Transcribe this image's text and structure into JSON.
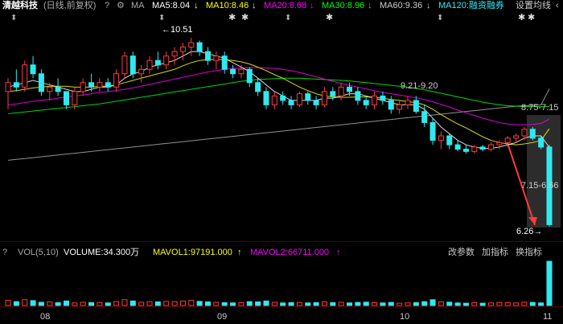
{
  "header": {
    "stock_name": "清越科技",
    "mode": "(日线,前复权)",
    "help": "?",
    "ma_label": "MA",
    "ma5": "MA5:8.04",
    "ma10": "MA10:8.46",
    "ma20": "MA20:8.68",
    "ma30": "MA30:8.96",
    "ma60": "MA60:9.36",
    "ma120": "MA120:融资融券",
    "settings": "设置均线",
    "arrow_down": "↓",
    "more": "‹"
  },
  "annotations": {
    "high": "10.51",
    "low": "6.26",
    "band1": "9.21-9.20",
    "band2": "8.75-7.15",
    "band3": "7.15-6.66"
  },
  "volume": {
    "header_left": "VOL(5,10)",
    "volume": "VOLUME:34.300万",
    "mavol1": "MAVOL1:97191.000",
    "mavol2": "MAVOL2:66711.000",
    "params": "改参数",
    "add_indicator": "加指标",
    "swap_indicator": "换指标",
    "help": "?"
  },
  "xaxis": [
    "08",
    "09",
    "10",
    "11"
  ],
  "colors": {
    "up": "#ff3b3b",
    "down": "#30e8f0",
    "ma5": "#ffffff",
    "ma10": "#ffff00",
    "ma20": "#ff00ff",
    "ma30": "#00ff00",
    "ma60": "#aaaaaa"
  },
  "chart_data": {
    "type": "candlestick",
    "ylim": [
      6.0,
      11.0
    ],
    "candles": [
      [
        9.3,
        9.6,
        8.9,
        9.5
      ],
      [
        9.5,
        9.8,
        9.3,
        9.4
      ],
      [
        9.4,
        10.0,
        9.3,
        9.9
      ],
      [
        9.9,
        10.1,
        9.6,
        9.7
      ],
      [
        9.7,
        9.8,
        9.2,
        9.3
      ],
      [
        9.3,
        9.5,
        9.1,
        9.4
      ],
      [
        9.4,
        9.6,
        9.2,
        9.3
      ],
      [
        9.3,
        9.3,
        8.9,
        9.0
      ],
      [
        9.0,
        9.4,
        8.9,
        9.3
      ],
      [
        9.3,
        9.6,
        9.2,
        9.5
      ],
      [
        9.5,
        9.7,
        9.3,
        9.4
      ],
      [
        9.4,
        9.6,
        9.3,
        9.5
      ],
      [
        9.5,
        9.6,
        9.3,
        9.4
      ],
      [
        9.4,
        9.8,
        9.3,
        9.7
      ],
      [
        9.7,
        10.2,
        9.6,
        10.1
      ],
      [
        10.1,
        10.2,
        9.6,
        9.7
      ],
      [
        9.7,
        9.9,
        9.5,
        9.8
      ],
      [
        9.8,
        10.1,
        9.7,
        10.0
      ],
      [
        10.0,
        10.2,
        9.8,
        9.9
      ],
      [
        9.9,
        10.2,
        9.8,
        10.1
      ],
      [
        10.1,
        10.3,
        9.9,
        10.2
      ],
      [
        10.2,
        10.4,
        10.0,
        10.3
      ],
      [
        10.3,
        10.51,
        10.1,
        10.4
      ],
      [
        10.4,
        10.45,
        10.1,
        10.2
      ],
      [
        10.2,
        10.3,
        9.9,
        10.0
      ],
      [
        10.0,
        10.2,
        9.8,
        10.1
      ],
      [
        10.1,
        10.2,
        9.7,
        9.8
      ],
      [
        9.8,
        9.9,
        9.6,
        9.7
      ],
      [
        9.7,
        9.9,
        9.6,
        9.8
      ],
      [
        9.8,
        9.85,
        9.4,
        9.5
      ],
      [
        9.5,
        9.6,
        9.2,
        9.3
      ],
      [
        9.3,
        9.4,
        8.9,
        9.0
      ],
      [
        9.0,
        9.3,
        8.9,
        9.2
      ],
      [
        9.2,
        9.3,
        9.0,
        9.1
      ],
      [
        9.1,
        9.2,
        8.9,
        9.0
      ],
      [
        9.0,
        9.3,
        8.95,
        9.25
      ],
      [
        9.25,
        9.3,
        9.0,
        9.1
      ],
      [
        9.1,
        9.2,
        8.9,
        9.0
      ],
      [
        9.0,
        9.4,
        8.95,
        9.3
      ],
      [
        9.3,
        9.4,
        9.1,
        9.2
      ],
      [
        9.2,
        9.5,
        9.1,
        9.4
      ],
      [
        9.4,
        9.5,
        9.2,
        9.3
      ],
      [
        9.3,
        9.4,
        9.0,
        9.1
      ],
      [
        9.1,
        9.2,
        8.9,
        9.0
      ],
      [
        9.0,
        9.3,
        8.9,
        9.2
      ],
      [
        9.2,
        9.3,
        9.0,
        9.1
      ],
      [
        9.1,
        9.2,
        8.8,
        8.9
      ],
      [
        8.9,
        9.1,
        8.8,
        9.0
      ],
      [
        9.0,
        9.2,
        8.9,
        9.1
      ],
      [
        9.1,
        9.2,
        8.8,
        8.85
      ],
      [
        8.85,
        9.0,
        8.5,
        8.6
      ],
      [
        8.6,
        8.7,
        8.1,
        8.2
      ],
      [
        8.2,
        8.4,
        8.0,
        8.3
      ],
      [
        8.3,
        8.35,
        8.0,
        8.1
      ],
      [
        8.1,
        8.2,
        7.95,
        8.0
      ],
      [
        8.0,
        8.1,
        7.9,
        7.95
      ],
      [
        7.95,
        8.1,
        7.9,
        8.05
      ],
      [
        8.05,
        8.1,
        7.95,
        8.0
      ],
      [
        8.0,
        8.15,
        7.95,
        8.1
      ],
      [
        8.1,
        8.2,
        8.0,
        8.15
      ],
      [
        8.15,
        8.3,
        8.05,
        8.25
      ],
      [
        8.25,
        8.35,
        8.15,
        8.3
      ],
      [
        8.3,
        8.5,
        8.2,
        8.45
      ],
      [
        8.45,
        8.5,
        8.2,
        8.25
      ],
      [
        8.25,
        8.3,
        8.0,
        8.05
      ],
      [
        8.05,
        8.1,
        6.26,
        6.3
      ]
    ],
    "ma5": [
      9.4,
      9.45,
      9.5,
      9.55,
      9.5,
      9.45,
      9.4,
      9.35,
      9.3,
      9.3,
      9.35,
      9.4,
      9.4,
      9.45,
      9.6,
      9.7,
      9.75,
      9.85,
      9.9,
      9.95,
      10.0,
      10.1,
      10.2,
      10.2,
      10.15,
      10.1,
      10.05,
      9.95,
      9.85,
      9.75,
      9.6,
      9.45,
      9.3,
      9.2,
      9.1,
      9.1,
      9.1,
      9.1,
      9.15,
      9.15,
      9.2,
      9.25,
      9.25,
      9.2,
      9.15,
      9.1,
      9.05,
      9.0,
      9.0,
      9.0,
      8.9,
      8.7,
      8.5,
      8.35,
      8.2,
      8.1,
      8.05,
      8.02,
      8.02,
      8.05,
      8.1,
      8.15,
      8.25,
      8.3,
      8.3,
      8.04
    ],
    "ma10": [
      9.3,
      9.32,
      9.35,
      9.38,
      9.4,
      9.42,
      9.42,
      9.42,
      9.4,
      9.4,
      9.4,
      9.42,
      9.42,
      9.45,
      9.5,
      9.55,
      9.6,
      9.65,
      9.7,
      9.75,
      9.8,
      9.88,
      9.95,
      10.0,
      10.02,
      10.02,
      10.02,
      10.0,
      9.97,
      9.92,
      9.85,
      9.77,
      9.68,
      9.6,
      9.5,
      9.4,
      9.32,
      9.25,
      9.2,
      9.18,
      9.17,
      9.17,
      9.18,
      9.18,
      9.17,
      9.15,
      9.12,
      9.1,
      9.07,
      9.05,
      9.0,
      8.9,
      8.78,
      8.67,
      8.57,
      8.48,
      8.38,
      8.28,
      8.2,
      8.15,
      8.12,
      8.1,
      8.12,
      8.15,
      8.2,
      8.46
    ],
    "ma20": [
      9.0,
      9.02,
      9.05,
      9.08,
      9.1,
      9.12,
      9.15,
      9.18,
      9.2,
      9.22,
      9.25,
      9.28,
      9.3,
      9.32,
      9.35,
      9.38,
      9.42,
      9.46,
      9.5,
      9.54,
      9.58,
      9.62,
      9.66,
      9.7,
      9.74,
      9.77,
      9.8,
      9.82,
      9.83,
      9.84,
      9.84,
      9.83,
      9.82,
      9.8,
      9.77,
      9.73,
      9.68,
      9.63,
      9.58,
      9.53,
      9.48,
      9.44,
      9.4,
      9.36,
      9.32,
      9.28,
      9.25,
      9.22,
      9.19,
      9.16,
      9.12,
      9.07,
      9.01,
      8.95,
      8.88,
      8.82,
      8.76,
      8.7,
      8.65,
      8.6,
      8.57,
      8.55,
      8.55,
      8.56,
      8.58,
      8.68
    ],
    "ma30": [
      8.8,
      8.82,
      8.84,
      8.86,
      8.88,
      8.9,
      8.92,
      8.94,
      8.96,
      8.98,
      9.0,
      9.02,
      9.05,
      9.08,
      9.11,
      9.14,
      9.17,
      9.2,
      9.23,
      9.26,
      9.29,
      9.32,
      9.35,
      9.38,
      9.41,
      9.44,
      9.47,
      9.5,
      9.53,
      9.55,
      9.57,
      9.58,
      9.59,
      9.6,
      9.6,
      9.6,
      9.59,
      9.58,
      9.57,
      9.56,
      9.55,
      9.54,
      9.52,
      9.5,
      9.48,
      9.46,
      9.44,
      9.42,
      9.4,
      9.37,
      9.34,
      9.3,
      9.26,
      9.22,
      9.18,
      9.14,
      9.1,
      9.06,
      9.03,
      9.0,
      8.98,
      8.97,
      8.96,
      8.96,
      8.96,
      8.96
    ],
    "ma60": [
      7.75,
      7.77,
      7.79,
      7.81,
      7.83,
      7.85,
      7.87,
      7.89,
      7.91,
      7.93,
      7.95,
      7.97,
      7.99,
      8.01,
      8.03,
      8.05,
      8.07,
      8.09,
      8.11,
      8.13,
      8.15,
      8.17,
      8.19,
      8.21,
      8.23,
      8.25,
      8.27,
      8.29,
      8.31,
      8.33,
      8.35,
      8.37,
      8.39,
      8.41,
      8.43,
      8.45,
      8.47,
      8.49,
      8.51,
      8.53,
      8.55,
      8.57,
      8.59,
      8.61,
      8.63,
      8.65,
      8.67,
      8.69,
      8.71,
      8.73,
      8.75,
      8.77,
      8.79,
      8.81,
      8.83,
      8.85,
      8.87,
      8.89,
      8.91,
      8.93,
      8.95,
      8.97,
      8.98,
      8.99,
      9.0,
      9.36
    ],
    "volumes": [
      40,
      30,
      45,
      38,
      25,
      28,
      22,
      35,
      20,
      25,
      22,
      24,
      20,
      30,
      45,
      35,
      25,
      30,
      28,
      32,
      30,
      35,
      40,
      32,
      28,
      25,
      22,
      20,
      22,
      30,
      28,
      35,
      25,
      20,
      22,
      24,
      20,
      22,
      28,
      22,
      25,
      20,
      24,
      26,
      22,
      20,
      24,
      18,
      20,
      22,
      30,
      45,
      28,
      26,
      20,
      18,
      22,
      18,
      20,
      24,
      22,
      20,
      26,
      24,
      20,
      343
    ]
  }
}
